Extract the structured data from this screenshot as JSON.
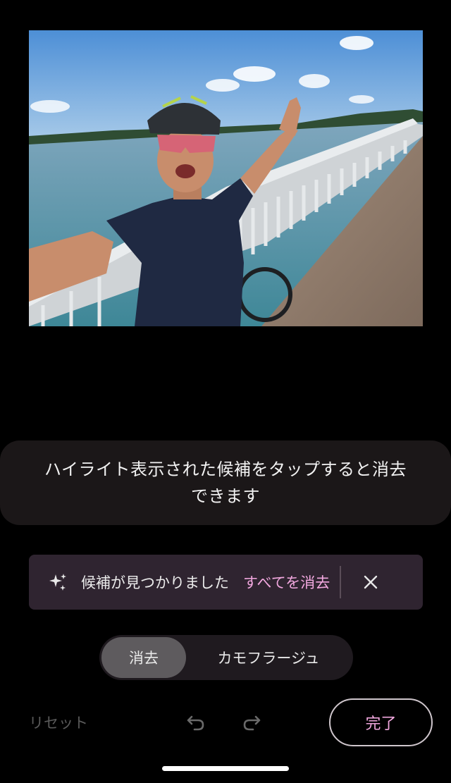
{
  "photo": {
    "subject": "selfie-cyclist-on-bridge-icon"
  },
  "hint": {
    "text": "ハイライト表示された候補をタップすると消去\nできます"
  },
  "banner": {
    "icon": "sparkle-icon",
    "message": "候補が見つかりました",
    "action_label": "すべてを消去",
    "close_icon": "close-icon"
  },
  "segment": {
    "items": [
      {
        "label": "消去",
        "active": true
      },
      {
        "label": "カモフラージュ",
        "active": false
      }
    ]
  },
  "toolbar": {
    "reset_label": "リセット",
    "undo_icon": "undo-icon",
    "redo_icon": "redo-icon",
    "done_label": "完了"
  },
  "colors": {
    "accent": "#f2a8df",
    "banner_bg": "#2f2430",
    "hint_bg": "#1b1718",
    "segment_active": "#5e5b5e"
  }
}
